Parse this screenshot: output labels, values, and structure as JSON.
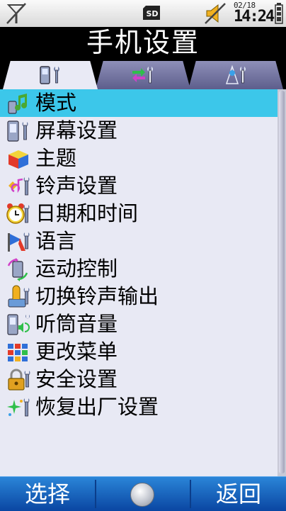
{
  "status": {
    "date": "02/18",
    "time": "14:24",
    "icons": [
      "no-signal-icon",
      "sd-card-icon",
      "silent-mode-icon",
      "battery-icon"
    ],
    "sd_label": "SD"
  },
  "title": "手机设置",
  "tabs": [
    {
      "name": "phone-settings-tab",
      "icon": "phone-wrench-icon",
      "active": true
    },
    {
      "name": "connection-settings-tab",
      "icon": "arrows-wrench-icon",
      "active": false
    },
    {
      "name": "network-settings-tab",
      "icon": "antenna-wrench-icon",
      "active": false
    }
  ],
  "menu": {
    "selected_index": 0,
    "items": [
      {
        "label": "模式",
        "icon": "mode-icon"
      },
      {
        "label": "屏幕设置",
        "icon": "screen-settings-icon"
      },
      {
        "label": "主题",
        "icon": "theme-icon"
      },
      {
        "label": "铃声设置",
        "icon": "ringtone-icon"
      },
      {
        "label": "日期和时间",
        "icon": "alarm-clock-icon"
      },
      {
        "label": "语言",
        "icon": "language-icon"
      },
      {
        "label": "运动控制",
        "icon": "motion-control-icon"
      },
      {
        "label": "切换铃声输出",
        "icon": "ring-output-icon"
      },
      {
        "label": "听筒音量",
        "icon": "earpiece-volume-icon"
      },
      {
        "label": "更改菜单",
        "icon": "change-menu-icon"
      },
      {
        "label": "安全设置",
        "icon": "lock-icon"
      },
      {
        "label": "恢复出厂设置",
        "icon": "factory-reset-icon"
      }
    ]
  },
  "softkeys": {
    "left": "选择",
    "right": "返回"
  },
  "colors": {
    "selection": "#3cc7ea",
    "list_bg": "#e8e9f4",
    "softkey_bar": "#1560c0"
  }
}
